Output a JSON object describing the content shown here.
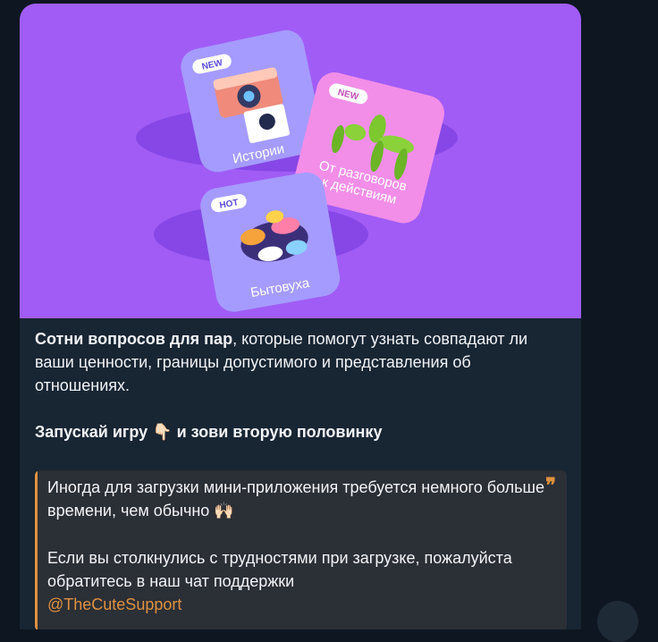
{
  "banner": {
    "card_istorii": {
      "badge": "NEW",
      "label": "Истории"
    },
    "card_razgovory": {
      "badge": "NEW",
      "label_line1": "От разговоров",
      "label_line2": "к действиям"
    },
    "card_bytovukha": {
      "badge": "HOT",
      "label": "Бытовуха"
    }
  },
  "caption": {
    "bold_lead": "Сотни вопросов для пар",
    "rest": ", которые помогут узнать совпадают ли ваши ценности, границы допустимого и представления об отношениях.",
    "cta_start": "Запускай игру ",
    "cta_emoji": "👇🏻",
    "cta_end": " и зови вторую половинку"
  },
  "quote": {
    "mark": "❞",
    "line1": "Иногда для загрузки мини-приложения требуется немного больше времени, чем обычно ",
    "line1_emoji": "🙌🏻",
    "line2": "Если вы столкнулись с трудностями при загрузке, пожалуйста обратитесь в наш чат поддержки",
    "link": "@TheCuteSupport"
  },
  "colors": {
    "background": "#0e1621",
    "bubble": "#182533",
    "banner": "#a15cf6",
    "quote_accent": "#e0913f"
  }
}
